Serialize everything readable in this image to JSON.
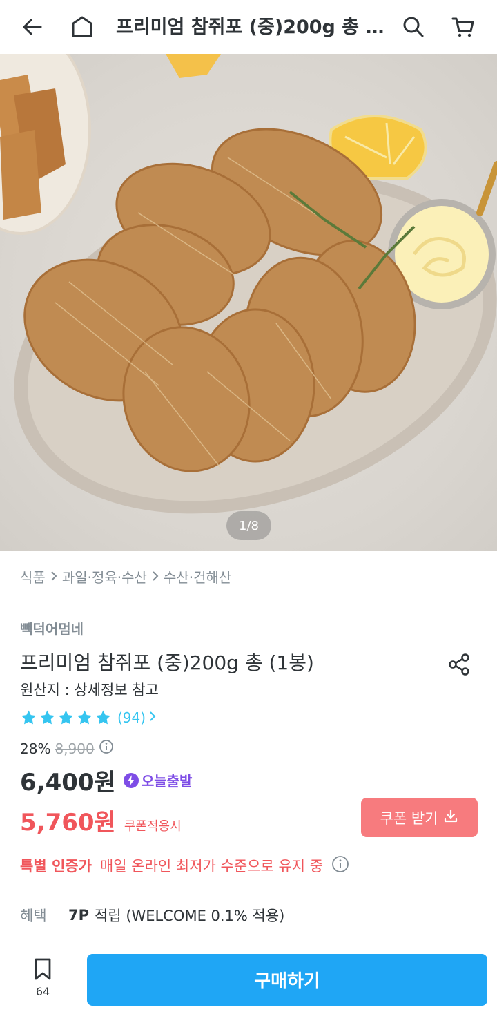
{
  "header": {
    "title": "프리미엄 참쥐포 (중)200g 총 (1봉)",
    "icons": [
      "back-arrow-icon",
      "home-icon",
      "search-icon",
      "cart-icon"
    ]
  },
  "hero": {
    "counter": "1/8"
  },
  "breadcrumb": [
    "식품",
    "과일·정육·수산",
    "수산·건해산"
  ],
  "product": {
    "brand": "빽덕어멈네",
    "name": "프리미엄 참쥐포 (중)200g 총 (1봉)",
    "origin": "원산지 : 상세정보 참고",
    "rating": {
      "stars": 5,
      "review_count": "(94)"
    },
    "discount_rate": "28%",
    "original_price": "8,900",
    "price": "6,400원",
    "today_badge": "오늘출발",
    "coupon_price": "5,760원",
    "coupon_note": "쿠폰적용시",
    "coupon_button": "쿠폰 받기",
    "cert_label": "특별 인증가",
    "cert_text": "매일 온라인 최저가 수준으로 유지 중",
    "benefit_label": "혜택",
    "benefit_points": "7P",
    "benefit_text": "적립 (WELCOME 0.1% 적용)"
  },
  "bottom": {
    "bookmark_count": "64",
    "buy_label": "구매하기"
  },
  "colors": {
    "accent_blue": "#1fa6f5",
    "star_blue": "#35c5f0",
    "coupon_red": "#f0565b",
    "coupon_button": "#f77b7e",
    "today_purple": "#7e4de6"
  }
}
